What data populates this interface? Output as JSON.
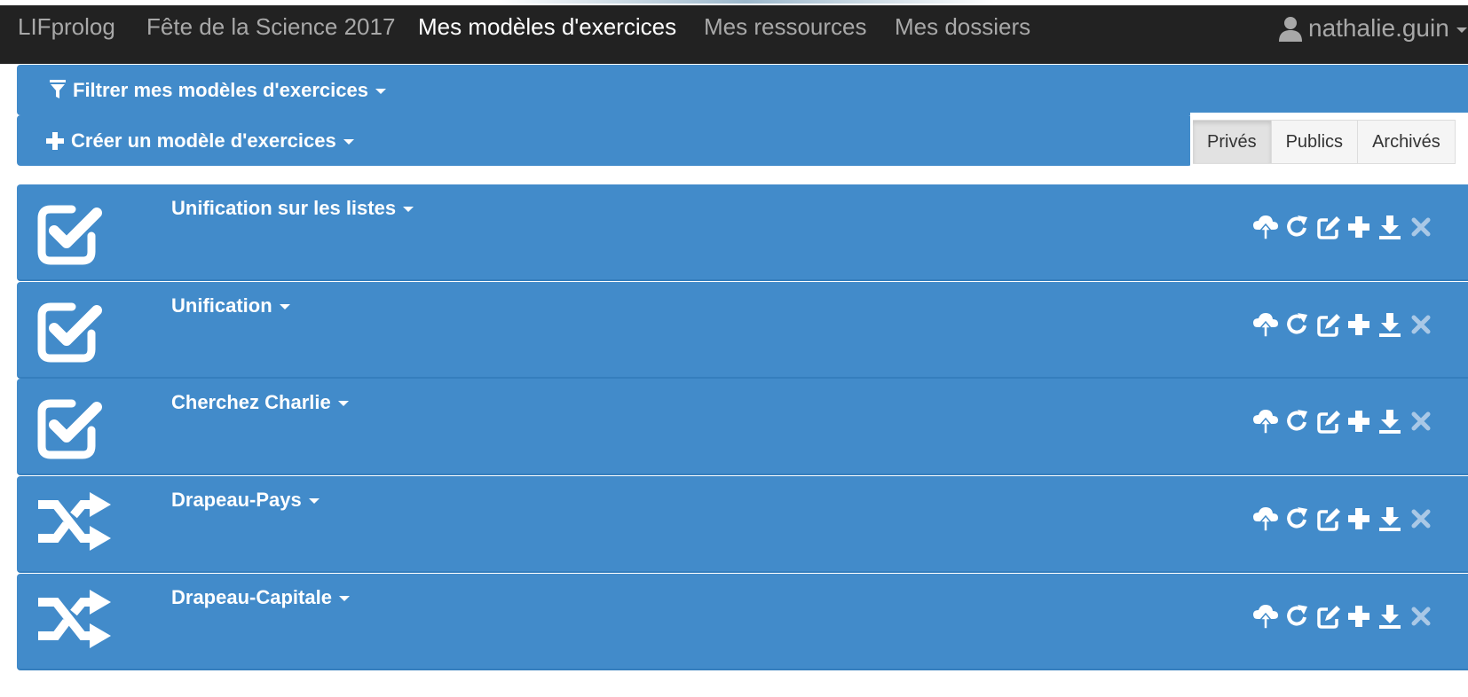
{
  "navbar": {
    "brand": "LIFprolog",
    "items": [
      {
        "label": "Fête de la Science 2017",
        "active": false
      },
      {
        "label": "Mes modèles d'exercices",
        "active": true
      },
      {
        "label": "Mes ressources",
        "active": false
      },
      {
        "label": "Mes dossiers",
        "active": false
      }
    ],
    "user": {
      "name": "nathalie.guin",
      "icon": "user-icon"
    }
  },
  "filter": {
    "label": "Filtrer mes modèles d'exercices",
    "icon": "filter-icon"
  },
  "create": {
    "label": "Créer un modèle d'exercices",
    "icon": "plus-icon"
  },
  "visibility_tabs": [
    {
      "label": "Privés",
      "active": true
    },
    {
      "label": "Publics",
      "active": false
    },
    {
      "label": "Archivés",
      "active": false
    }
  ],
  "exercises": [
    {
      "title": "Unification sur les listes",
      "type_icon": "checkbox-check-icon"
    },
    {
      "title": "Unification",
      "type_icon": "checkbox-check-icon"
    },
    {
      "title": "Cherchez Charlie",
      "type_icon": "checkbox-check-icon"
    },
    {
      "title": "Drapeau-Pays",
      "type_icon": "shuffle-icon"
    },
    {
      "title": "Drapeau-Capitale",
      "type_icon": "shuffle-icon"
    }
  ],
  "row_actions": [
    "cloud-upload-icon",
    "refresh-icon",
    "edit-icon",
    "plus-icon",
    "download-icon",
    "remove-icon"
  ],
  "colors": {
    "navbar": "#222222",
    "primary": "#428bca",
    "nav_text": "#a8a8a8",
    "active_nav_text": "#ffffff"
  }
}
